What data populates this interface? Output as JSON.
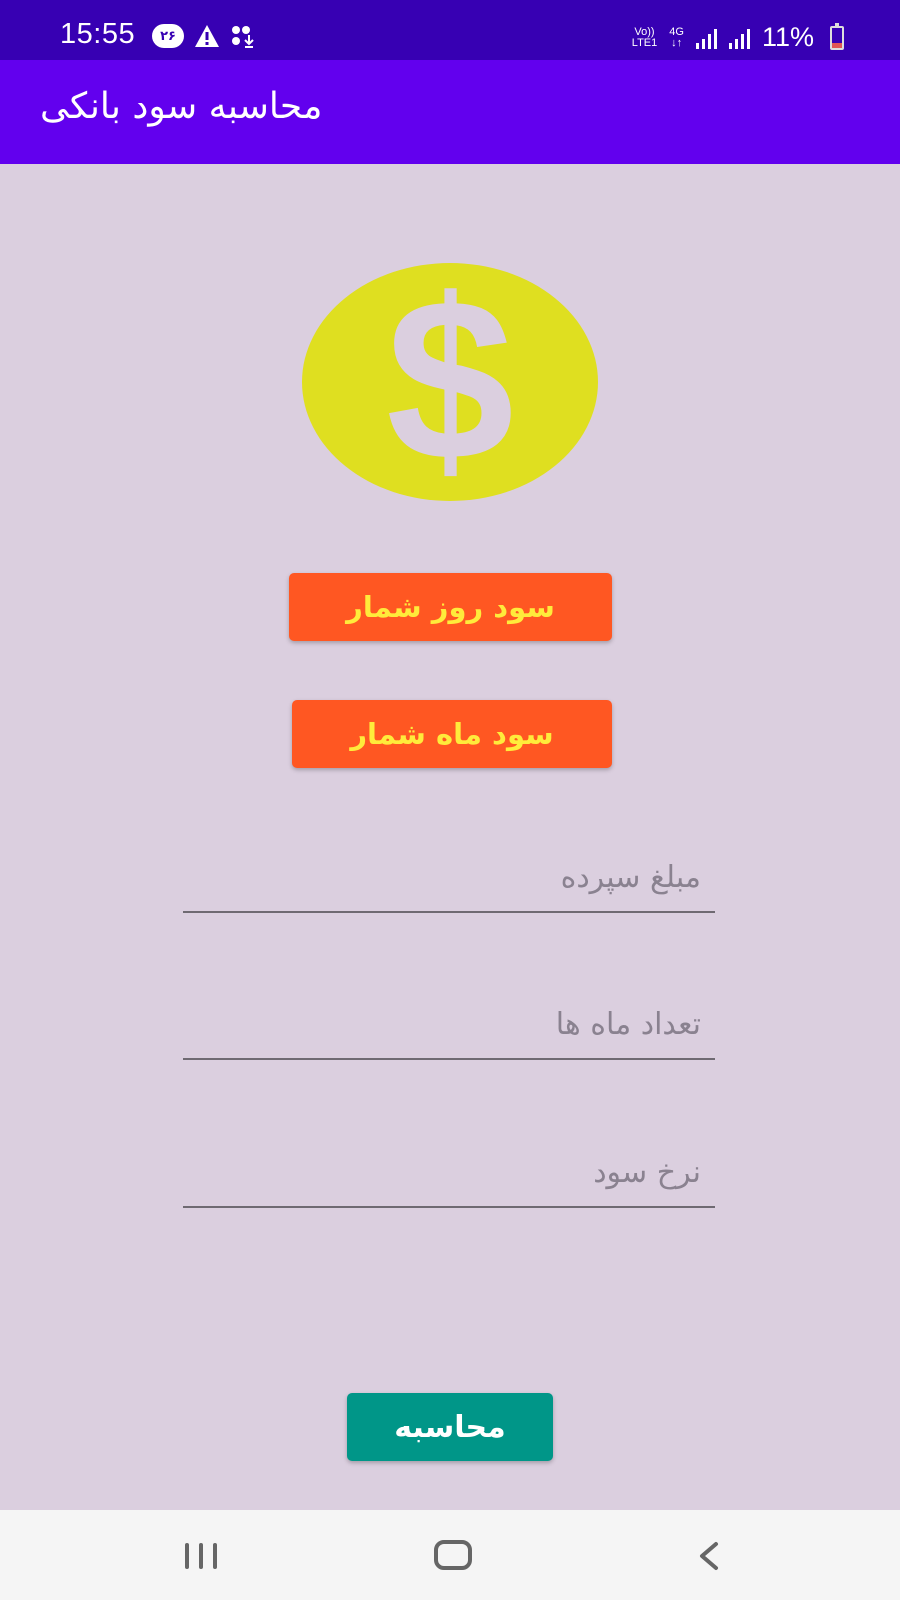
{
  "status_bar": {
    "time": "15:55",
    "notification_badge": "۲۶",
    "network_top": "Vo))",
    "network_bottom": "LTE1",
    "network_type": "4G",
    "battery": "11%"
  },
  "app_bar": {
    "title": "محاسبه سود بانکی"
  },
  "logo": {
    "symbol": "$",
    "color": "#DFDF20"
  },
  "buttons": {
    "daily_interest": "سود روز شمار",
    "monthly_interest": "سود ماه شمار",
    "calculate": "محاسبه"
  },
  "fields": {
    "deposit_placeholder": "مبلغ سپرده",
    "months_placeholder": "تعداد ماه ها",
    "rate_placeholder": "نرخ سود"
  },
  "colors": {
    "status_bar": "#3700B3",
    "app_bar": "#6200EE",
    "background": "#DBCFDF",
    "orange_button": "#FF5722",
    "orange_button_text": "#FFEB3B",
    "calculate_button": "#009688"
  },
  "icons": {
    "recent_apps": "recent-apps-icon",
    "home": "home-icon",
    "back": "back-icon"
  }
}
